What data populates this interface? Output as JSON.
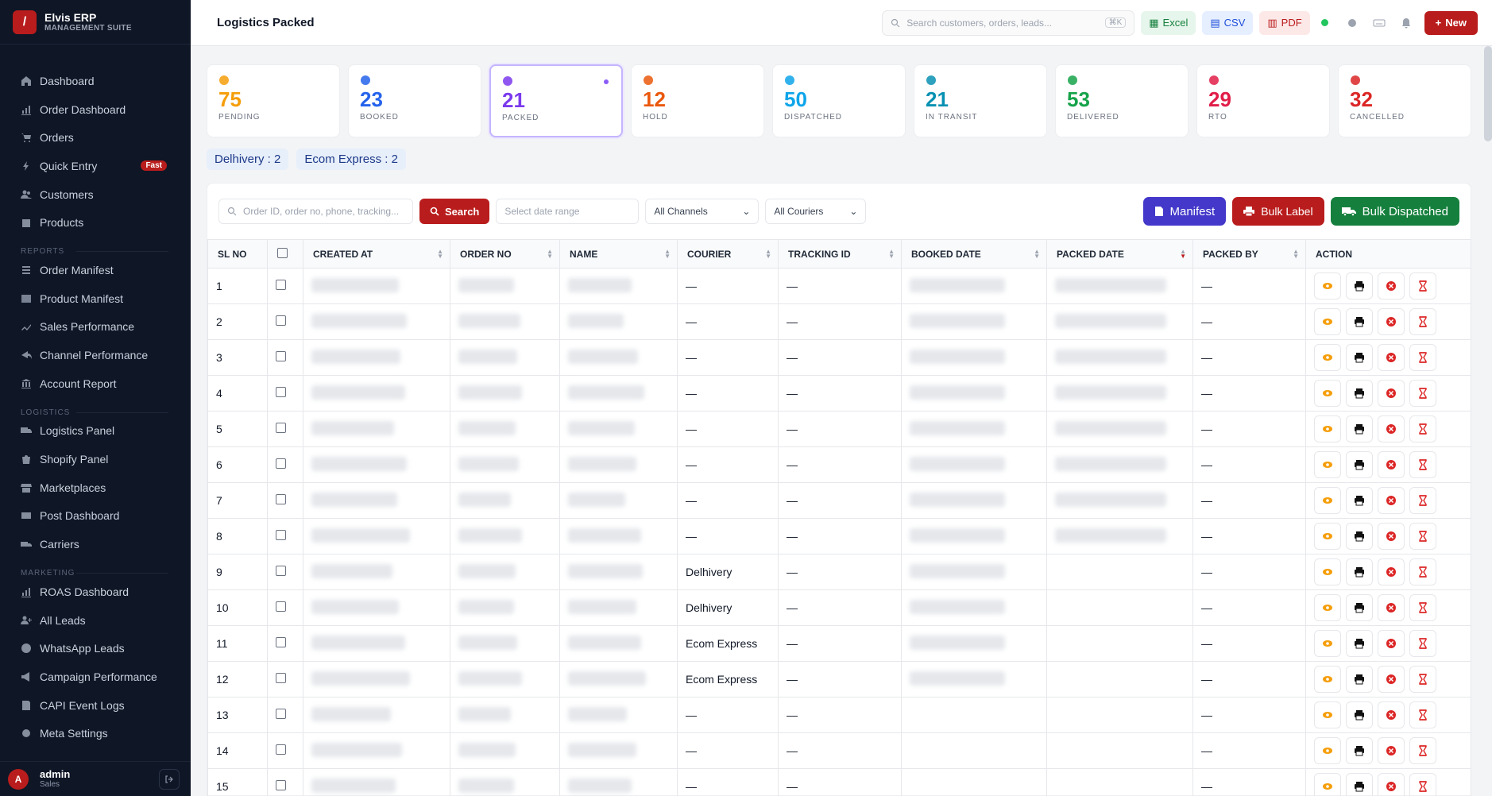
{
  "brand": {
    "name": "Elvis ERP",
    "subtitle": "MANAGEMENT SUITE",
    "logo_letter": "/"
  },
  "sidebar": {
    "main": [
      {
        "label": "Dashboard",
        "icon": "home-icon"
      },
      {
        "label": "Order Dashboard",
        "icon": "chart-icon"
      },
      {
        "label": "Orders",
        "icon": "cart-icon"
      },
      {
        "label": "Quick Entry",
        "icon": "bolt-icon",
        "badge": "Fast"
      },
      {
        "label": "Customers",
        "icon": "users-icon"
      },
      {
        "label": "Products",
        "icon": "box-icon"
      }
    ],
    "reports_title": "REPORTS",
    "reports": [
      {
        "label": "Order Manifest",
        "icon": "list-icon"
      },
      {
        "label": "Product Manifest",
        "icon": "grid-icon"
      },
      {
        "label": "Sales Performance",
        "icon": "trend-icon"
      },
      {
        "label": "Channel Performance",
        "icon": "share-icon"
      },
      {
        "label": "Account Report",
        "icon": "bank-icon"
      }
    ],
    "logistics_title": "LOGISTICS",
    "logistics": [
      {
        "label": "Logistics Panel",
        "icon": "truck-icon"
      },
      {
        "label": "Shopify Panel",
        "icon": "bag-icon"
      },
      {
        "label": "Marketplaces",
        "icon": "store-icon"
      },
      {
        "label": "Post Dashboard",
        "icon": "mail-icon"
      },
      {
        "label": "Carriers",
        "icon": "carrier-icon"
      }
    ],
    "marketing_title": "MARKETING",
    "marketing": [
      {
        "label": "ROAS Dashboard",
        "icon": "chart-icon"
      },
      {
        "label": "All Leads",
        "icon": "user-plus-icon"
      },
      {
        "label": "WhatsApp Leads",
        "icon": "whatsapp-icon"
      },
      {
        "label": "Campaign Performance",
        "icon": "megaphone-icon"
      },
      {
        "label": "CAPI Event Logs",
        "icon": "log-icon"
      },
      {
        "label": "Meta Settings",
        "icon": "gear-icon"
      }
    ]
  },
  "user": {
    "avatar": "A",
    "name": "admin",
    "role": "Sales"
  },
  "topbar": {
    "title": "Logistics Packed",
    "search_placeholder": "Search customers, orders, leads...",
    "search_kbd": "⌘K",
    "excel": "Excel",
    "csv": "CSV",
    "pdf": "PDF",
    "new": "New"
  },
  "stats": [
    {
      "value": "75",
      "label": "PENDING",
      "color": "#f59e0b"
    },
    {
      "value": "23",
      "label": "BOOKED",
      "color": "#2563eb"
    },
    {
      "value": "21",
      "label": "PACKED",
      "color": "#7c3aed"
    },
    {
      "value": "12",
      "label": "HOLD",
      "color": "#ea580c"
    },
    {
      "value": "50",
      "label": "DISPATCHED",
      "color": "#0ea5e9"
    },
    {
      "value": "21",
      "label": "IN TRANSIT",
      "color": "#0891b2"
    },
    {
      "value": "53",
      "label": "DELIVERED",
      "color": "#16a34a"
    },
    {
      "value": "29",
      "label": "RTO",
      "color": "#e11d48"
    },
    {
      "value": "32",
      "label": "CANCELLED",
      "color": "#dc2626"
    }
  ],
  "chips": [
    "Delhivery : 2",
    "Ecom Express : 2"
  ],
  "filters": {
    "search_placeholder": "Order ID, order no, phone, tracking...",
    "search_button": "Search",
    "date_placeholder": "Select date range",
    "channel": "All Channels",
    "courier": "All Couriers",
    "manifest": "Manifest",
    "bulk_label": "Bulk Label",
    "bulk_dispatched": "Bulk Dispatched"
  },
  "table": {
    "headers": [
      "SL NO",
      "",
      "CREATED AT",
      "ORDER NO",
      "NAME",
      "COURIER",
      "TRACKING ID",
      "BOOKED DATE",
      "PACKED DATE",
      "PACKED BY",
      "ACTION"
    ],
    "rows": [
      {
        "sl": "1",
        "courier": "—",
        "tracking": "—",
        "packed_by": "—"
      },
      {
        "sl": "2",
        "courier": "—",
        "tracking": "—",
        "packed_by": "—"
      },
      {
        "sl": "3",
        "courier": "—",
        "tracking": "—",
        "packed_by": "—"
      },
      {
        "sl": "4",
        "courier": "—",
        "tracking": "—",
        "packed_by": "—"
      },
      {
        "sl": "5",
        "courier": "—",
        "tracking": "—",
        "packed_by": "—"
      },
      {
        "sl": "6",
        "courier": "—",
        "tracking": "—",
        "packed_by": "—"
      },
      {
        "sl": "7",
        "courier": "—",
        "tracking": "—",
        "packed_by": "—"
      },
      {
        "sl": "8",
        "courier": "—",
        "tracking": "—",
        "packed_by": "—"
      },
      {
        "sl": "9",
        "courier": "Delhivery",
        "tracking": "—",
        "packed_by": "—"
      },
      {
        "sl": "10",
        "courier": "Delhivery",
        "tracking": "—",
        "packed_by": "—"
      },
      {
        "sl": "11",
        "courier": "Ecom Express",
        "tracking": "—",
        "packed_by": "—"
      },
      {
        "sl": "12",
        "courier": "Ecom Express",
        "tracking": "—",
        "packed_by": "—"
      },
      {
        "sl": "13",
        "courier": "—",
        "tracking": "—",
        "packed_by": "—"
      },
      {
        "sl": "14",
        "courier": "—",
        "tracking": "—",
        "packed_by": "—"
      },
      {
        "sl": "15",
        "courier": "—",
        "tracking": "—",
        "packed_by": "—"
      }
    ]
  }
}
